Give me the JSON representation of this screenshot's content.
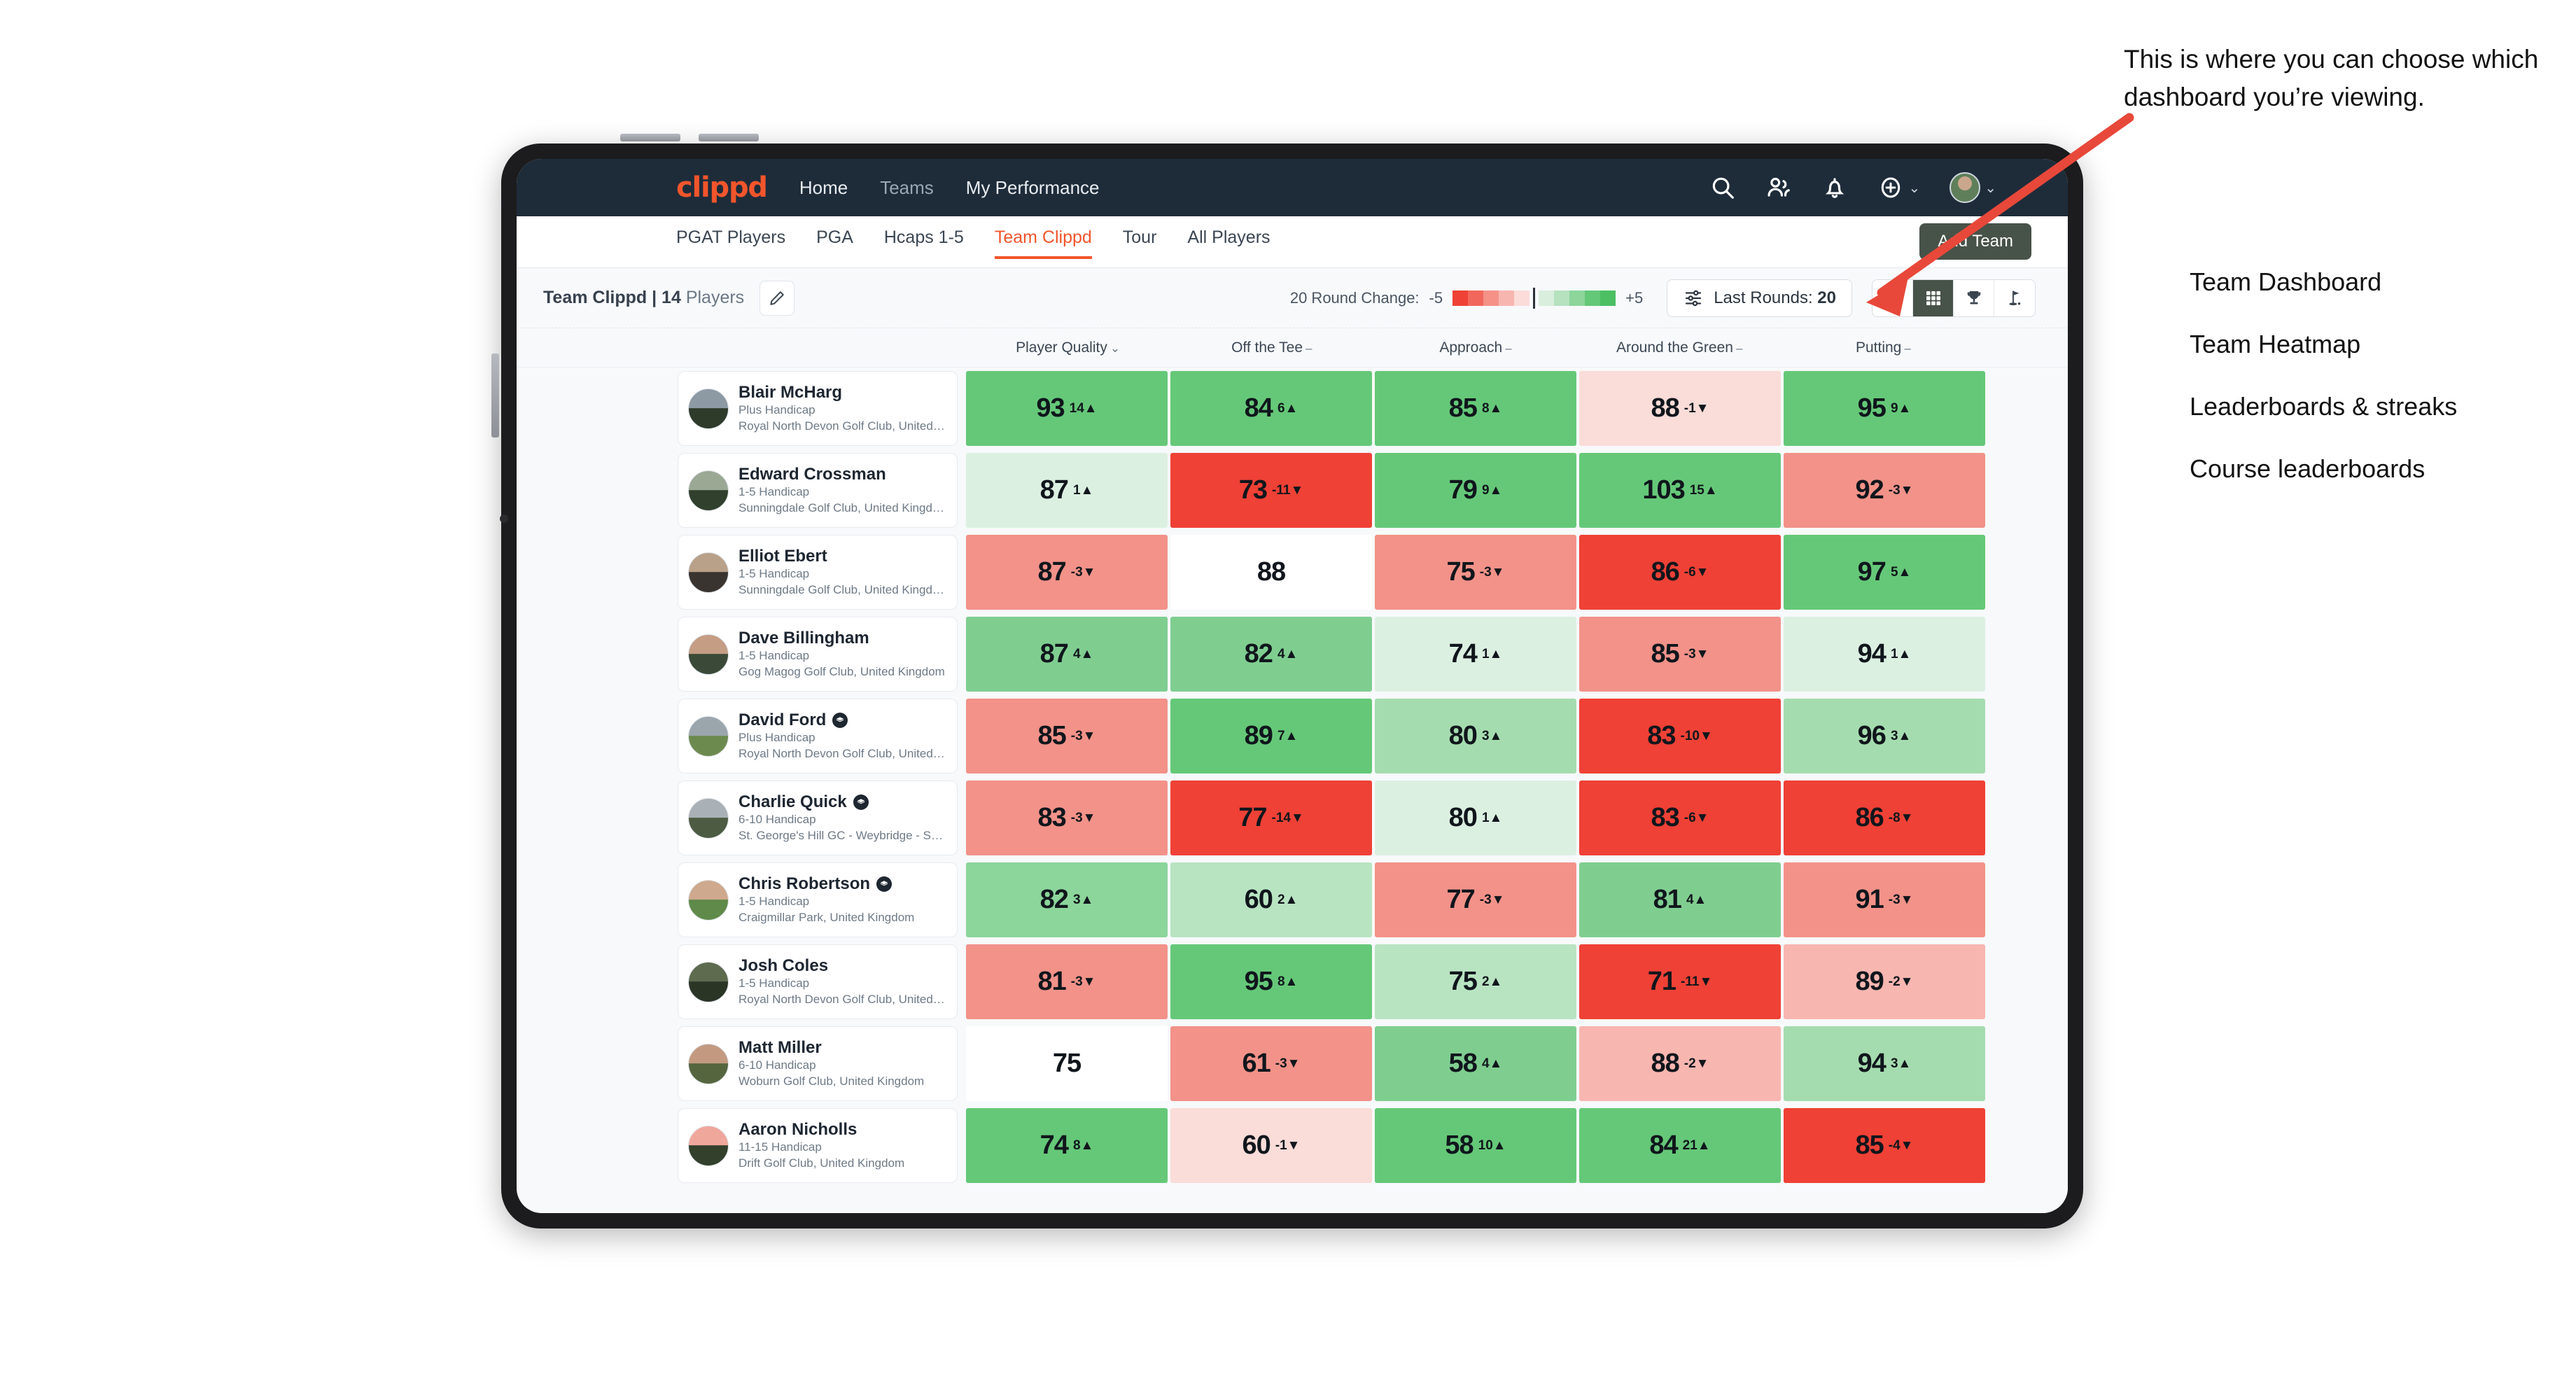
{
  "topnav": {
    "brand": "clippd",
    "links": [
      {
        "label": "Home",
        "active": true
      },
      {
        "label": "Teams",
        "active": false
      },
      {
        "label": "My Performance",
        "active": true
      }
    ],
    "icons": [
      "search-icon",
      "people-icon",
      "bell-icon",
      "plus-circle-icon"
    ],
    "accent": "#f2552c",
    "background": "#1e2c3a"
  },
  "tabs": {
    "items": [
      {
        "label": "PGAT Players",
        "active": false
      },
      {
        "label": "PGA",
        "active": false
      },
      {
        "label": "Hcaps 1-5",
        "active": false
      },
      {
        "label": "Team Clippd",
        "active": true
      },
      {
        "label": "Tour",
        "active": false
      },
      {
        "label": "All Players",
        "active": false
      }
    ],
    "add_team_label": "Add Team"
  },
  "toolbar": {
    "team_label_bold": "Team Clippd | 14",
    "team_label_muted": "Players",
    "edit_icon": "pencil-icon",
    "legend_label": "20 Round Change:",
    "legend_min": "-5",
    "legend_max": "+5",
    "legend_colors": [
      "#ef4136",
      "#f2675c",
      "#f59187",
      "#f8b6b0",
      "#fbdcd9",
      "#daeede",
      "#b6e2bf",
      "#8cd59b",
      "#63c878",
      "#4cbf63"
    ],
    "rounds_label": "Last Rounds:",
    "rounds_value": "20",
    "rounds_icon": "sliders-icon",
    "views": [
      {
        "name": "dashboard-grid-icon",
        "active": false
      },
      {
        "name": "heatmap-grid-icon",
        "active": true
      },
      {
        "name": "trophy-icon",
        "active": false
      },
      {
        "name": "golf-flag-icon",
        "active": false
      }
    ]
  },
  "table": {
    "columns": [
      {
        "label": "Player Quality",
        "indicator": "⌄"
      },
      {
        "label": "Off the Tee",
        "indicator": "–"
      },
      {
        "label": "Approach",
        "indicator": "–"
      },
      {
        "label": "Around the Green",
        "indicator": "–"
      },
      {
        "label": "Putting",
        "indicator": "–"
      }
    ],
    "rows": [
      {
        "name": "Blair McHarg",
        "badge": false,
        "handicap": "Plus Handicap",
        "club": "Royal North Devon Golf Club, United Kingdom",
        "avatar": [
          "#8d9aa4",
          "#2e3a2a"
        ],
        "cells": [
          {
            "value": "93",
            "delta": "14",
            "dir": "up",
            "color": "#65c878"
          },
          {
            "value": "84",
            "delta": "6",
            "dir": "up",
            "color": "#65c878"
          },
          {
            "value": "85",
            "delta": "8",
            "dir": "up",
            "color": "#65c878"
          },
          {
            "value": "88",
            "delta": "-1",
            "dir": "down",
            "color": "#fadcd8"
          },
          {
            "value": "95",
            "delta": "9",
            "dir": "up",
            "color": "#65c878"
          }
        ]
      },
      {
        "name": "Edward Crossman",
        "badge": false,
        "handicap": "1-5 Handicap",
        "club": "Sunningdale Golf Club, United Kingdom",
        "avatar": [
          "#9aa894",
          "#30402c"
        ],
        "cells": [
          {
            "value": "87",
            "delta": "1",
            "dir": "up",
            "color": "#dcf0e2"
          },
          {
            "value": "73",
            "delta": "-11",
            "dir": "down",
            "color": "#ef4136"
          },
          {
            "value": "79",
            "delta": "9",
            "dir": "up",
            "color": "#65c878"
          },
          {
            "value": "103",
            "delta": "15",
            "dir": "up",
            "color": "#65c878"
          },
          {
            "value": "92",
            "delta": "-3",
            "dir": "down",
            "color": "#f29289"
          }
        ]
      },
      {
        "name": "Elliot Ebert",
        "badge": false,
        "handicap": "1-5 Handicap",
        "club": "Sunningdale Golf Club, United Kingdom",
        "avatar": [
          "#b9a089",
          "#3a3430"
        ],
        "cells": [
          {
            "value": "87",
            "delta": "-3",
            "dir": "down",
            "color": "#f29289"
          },
          {
            "value": "88",
            "delta": "",
            "dir": "",
            "color": "#ffffff"
          },
          {
            "value": "75",
            "delta": "-3",
            "dir": "down",
            "color": "#f29289"
          },
          {
            "value": "86",
            "delta": "-6",
            "dir": "down",
            "color": "#ef4136"
          },
          {
            "value": "97",
            "delta": "5",
            "dir": "up",
            "color": "#65c878"
          }
        ]
      },
      {
        "name": "Dave Billingham",
        "badge": false,
        "handicap": "1-5 Handicap",
        "club": "Gog Magog Golf Club, United Kingdom",
        "avatar": [
          "#c49d84",
          "#3b4a38"
        ],
        "cells": [
          {
            "value": "87",
            "delta": "4",
            "dir": "up",
            "color": "#7fce90"
          },
          {
            "value": "82",
            "delta": "4",
            "dir": "up",
            "color": "#7fce90"
          },
          {
            "value": "74",
            "delta": "1",
            "dir": "up",
            "color": "#dcf0e2"
          },
          {
            "value": "85",
            "delta": "-3",
            "dir": "down",
            "color": "#f29289"
          },
          {
            "value": "94",
            "delta": "1",
            "dir": "up",
            "color": "#dcf0e2"
          }
        ]
      },
      {
        "name": "David Ford",
        "badge": true,
        "handicap": "Plus Handicap",
        "club": "Royal North Devon Golf Club, United Kingdom",
        "avatar": [
          "#9ba6ac",
          "#6d8a4e"
        ],
        "cells": [
          {
            "value": "85",
            "delta": "-3",
            "dir": "down",
            "color": "#f29289"
          },
          {
            "value": "89",
            "delta": "7",
            "dir": "up",
            "color": "#65c878"
          },
          {
            "value": "80",
            "delta": "3",
            "dir": "up",
            "color": "#a5dcaf"
          },
          {
            "value": "83",
            "delta": "-10",
            "dir": "down",
            "color": "#ef4136"
          },
          {
            "value": "96",
            "delta": "3",
            "dir": "up",
            "color": "#a5dcaf"
          }
        ]
      },
      {
        "name": "Charlie Quick",
        "badge": true,
        "handicap": "6-10 Handicap",
        "club": "St. George's Hill GC - Weybridge - Surrey, Uni...",
        "avatar": [
          "#a9b1b6",
          "#4d5b42"
        ],
        "cells": [
          {
            "value": "83",
            "delta": "-3",
            "dir": "down",
            "color": "#f29289"
          },
          {
            "value": "77",
            "delta": "-14",
            "dir": "down",
            "color": "#ef4136"
          },
          {
            "value": "80",
            "delta": "1",
            "dir": "up",
            "color": "#dcf0e2"
          },
          {
            "value": "83",
            "delta": "-6",
            "dir": "down",
            "color": "#ef4136"
          },
          {
            "value": "86",
            "delta": "-8",
            "dir": "down",
            "color": "#ef4136"
          }
        ]
      },
      {
        "name": "Chris Robertson",
        "badge": true,
        "handicap": "1-5 Handicap",
        "club": "Craigmillar Park, United Kingdom",
        "avatar": [
          "#cfa98d",
          "#5f8a4a"
        ],
        "cells": [
          {
            "value": "82",
            "delta": "3",
            "dir": "up",
            "color": "#8cd59b"
          },
          {
            "value": "60",
            "delta": "2",
            "dir": "up",
            "color": "#b9e4c2"
          },
          {
            "value": "77",
            "delta": "-3",
            "dir": "down",
            "color": "#f29289"
          },
          {
            "value": "81",
            "delta": "4",
            "dir": "up",
            "color": "#7fce90"
          },
          {
            "value": "91",
            "delta": "-3",
            "dir": "down",
            "color": "#f29289"
          }
        ]
      },
      {
        "name": "Josh Coles",
        "badge": false,
        "handicap": "1-5 Handicap",
        "club": "Royal North Devon Golf Club, United Kingdom",
        "avatar": [
          "#5e6b4f",
          "#2b3526"
        ],
        "cells": [
          {
            "value": "81",
            "delta": "-3",
            "dir": "down",
            "color": "#f29289"
          },
          {
            "value": "95",
            "delta": "8",
            "dir": "up",
            "color": "#65c878"
          },
          {
            "value": "75",
            "delta": "2",
            "dir": "up",
            "color": "#b9e4c2"
          },
          {
            "value": "71",
            "delta": "-11",
            "dir": "down",
            "color": "#ef4136"
          },
          {
            "value": "89",
            "delta": "-2",
            "dir": "down",
            "color": "#f8b6b0"
          }
        ]
      },
      {
        "name": "Matt Miller",
        "badge": false,
        "handicap": "6-10 Handicap",
        "club": "Woburn Golf Club, United Kingdom",
        "avatar": [
          "#c39a80",
          "#55663f"
        ],
        "cells": [
          {
            "value": "75",
            "delta": "",
            "dir": "",
            "color": "#ffffff"
          },
          {
            "value": "61",
            "delta": "-3",
            "dir": "down",
            "color": "#f29289"
          },
          {
            "value": "58",
            "delta": "4",
            "dir": "up",
            "color": "#7fce90"
          },
          {
            "value": "88",
            "delta": "-2",
            "dir": "down",
            "color": "#f8b6b0"
          },
          {
            "value": "94",
            "delta": "3",
            "dir": "up",
            "color": "#a5dcaf"
          }
        ]
      },
      {
        "name": "Aaron Nicholls",
        "badge": false,
        "handicap": "11-15 Handicap",
        "club": "Drift Golf Club, United Kingdom",
        "avatar": [
          "#f0a79b",
          "#33402b"
        ],
        "cells": [
          {
            "value": "74",
            "delta": "8",
            "dir": "up",
            "color": "#65c878"
          },
          {
            "value": "60",
            "delta": "-1",
            "dir": "down",
            "color": "#fadcd8"
          },
          {
            "value": "58",
            "delta": "10",
            "dir": "up",
            "color": "#65c878"
          },
          {
            "value": "84",
            "delta": "21",
            "dir": "up",
            "color": "#65c878"
          },
          {
            "value": "85",
            "delta": "-4",
            "dir": "down",
            "color": "#ef4136"
          }
        ]
      }
    ]
  },
  "annotations": {
    "paragraph": "This is where you can choose which dashboard you’re viewing.",
    "items": [
      "Team Dashboard",
      "Team Heatmap",
      "Leaderboards & streaks",
      "Course leaderboards"
    ],
    "arrow_color": "#e8483a"
  }
}
